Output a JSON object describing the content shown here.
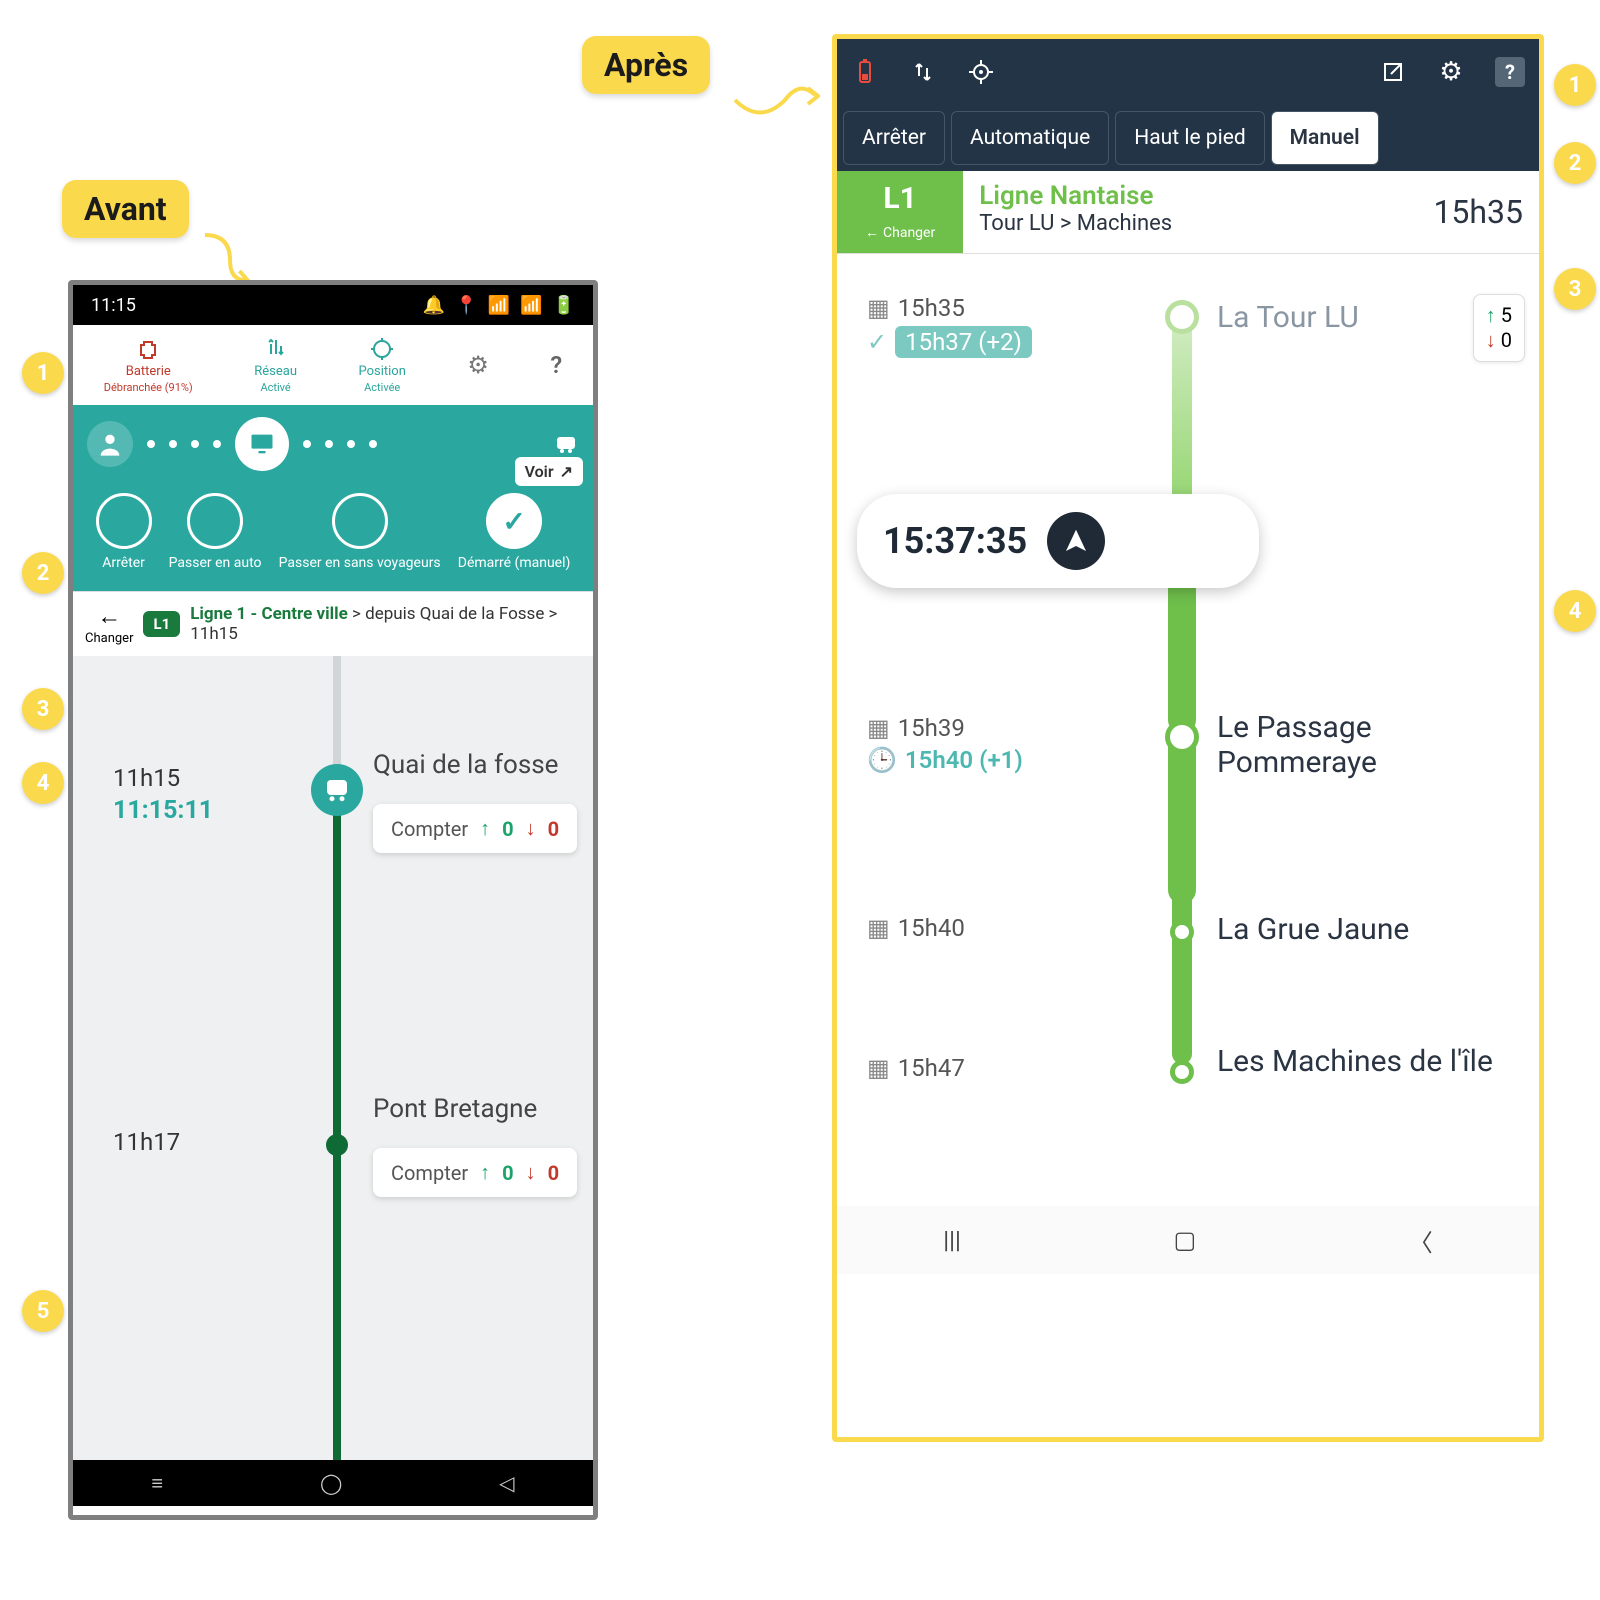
{
  "labels": {
    "avant": "Avant",
    "apres": "Après"
  },
  "avant": {
    "statusbar": {
      "time": "11:15"
    },
    "top": {
      "battery": {
        "label": "Batterie",
        "sub": "Débranchée (91%)"
      },
      "network": {
        "label": "Réseau",
        "sub": "Activé"
      },
      "position": {
        "label": "Position",
        "sub": "Activée"
      },
      "help": "?"
    },
    "voir": "Voir",
    "controls": {
      "arreter": "Arrêter",
      "auto": "Passer en auto",
      "sans": "Passer en sans voyageurs",
      "demarre": "Démarré (manuel)"
    },
    "line": {
      "changer": "Changer",
      "code": "L1",
      "name": "Ligne 1 - Centre ville",
      "rest": " > depuis Quai de la Fosse > 11h15"
    },
    "stops": {
      "s1": {
        "sched": "11h15",
        "live": "11:15:11",
        "name": "Quai de la fosse",
        "counter": "Compter",
        "up": "0",
        "down": "0"
      },
      "s2": {
        "sched": "11h17",
        "name": "Pont Bretagne",
        "counter": "Compter",
        "up": "0",
        "down": "0"
      }
    }
  },
  "apres": {
    "tabs": {
      "arreter": "Arrêter",
      "auto": "Automatique",
      "hlp": "Haut le pied",
      "manuel": "Manuel"
    },
    "line": {
      "code": "L1",
      "changer": "Changer",
      "name": "Ligne Nantaise",
      "route": "Tour LU > Machines",
      "time": "15h35"
    },
    "count": {
      "up": "5",
      "down": "0"
    },
    "current_time": "15:37:35",
    "stops": {
      "s1": {
        "sched": "15h35",
        "live": "15h37",
        "delta": "(+2)",
        "name": "La Tour LU"
      },
      "s2": {
        "sched": "15h39",
        "live": "15h40",
        "delta": "(+1)",
        "name": "Le Passage Pommeraye"
      },
      "s3": {
        "sched": "15h40",
        "name": "La Grue Jaune"
      },
      "s4": {
        "sched": "15h47",
        "name": "Les Machines de l'île"
      }
    }
  },
  "badges": {
    "b1": "1",
    "b2": "2",
    "b3": "3",
    "b4": "4",
    "b5": "5"
  }
}
